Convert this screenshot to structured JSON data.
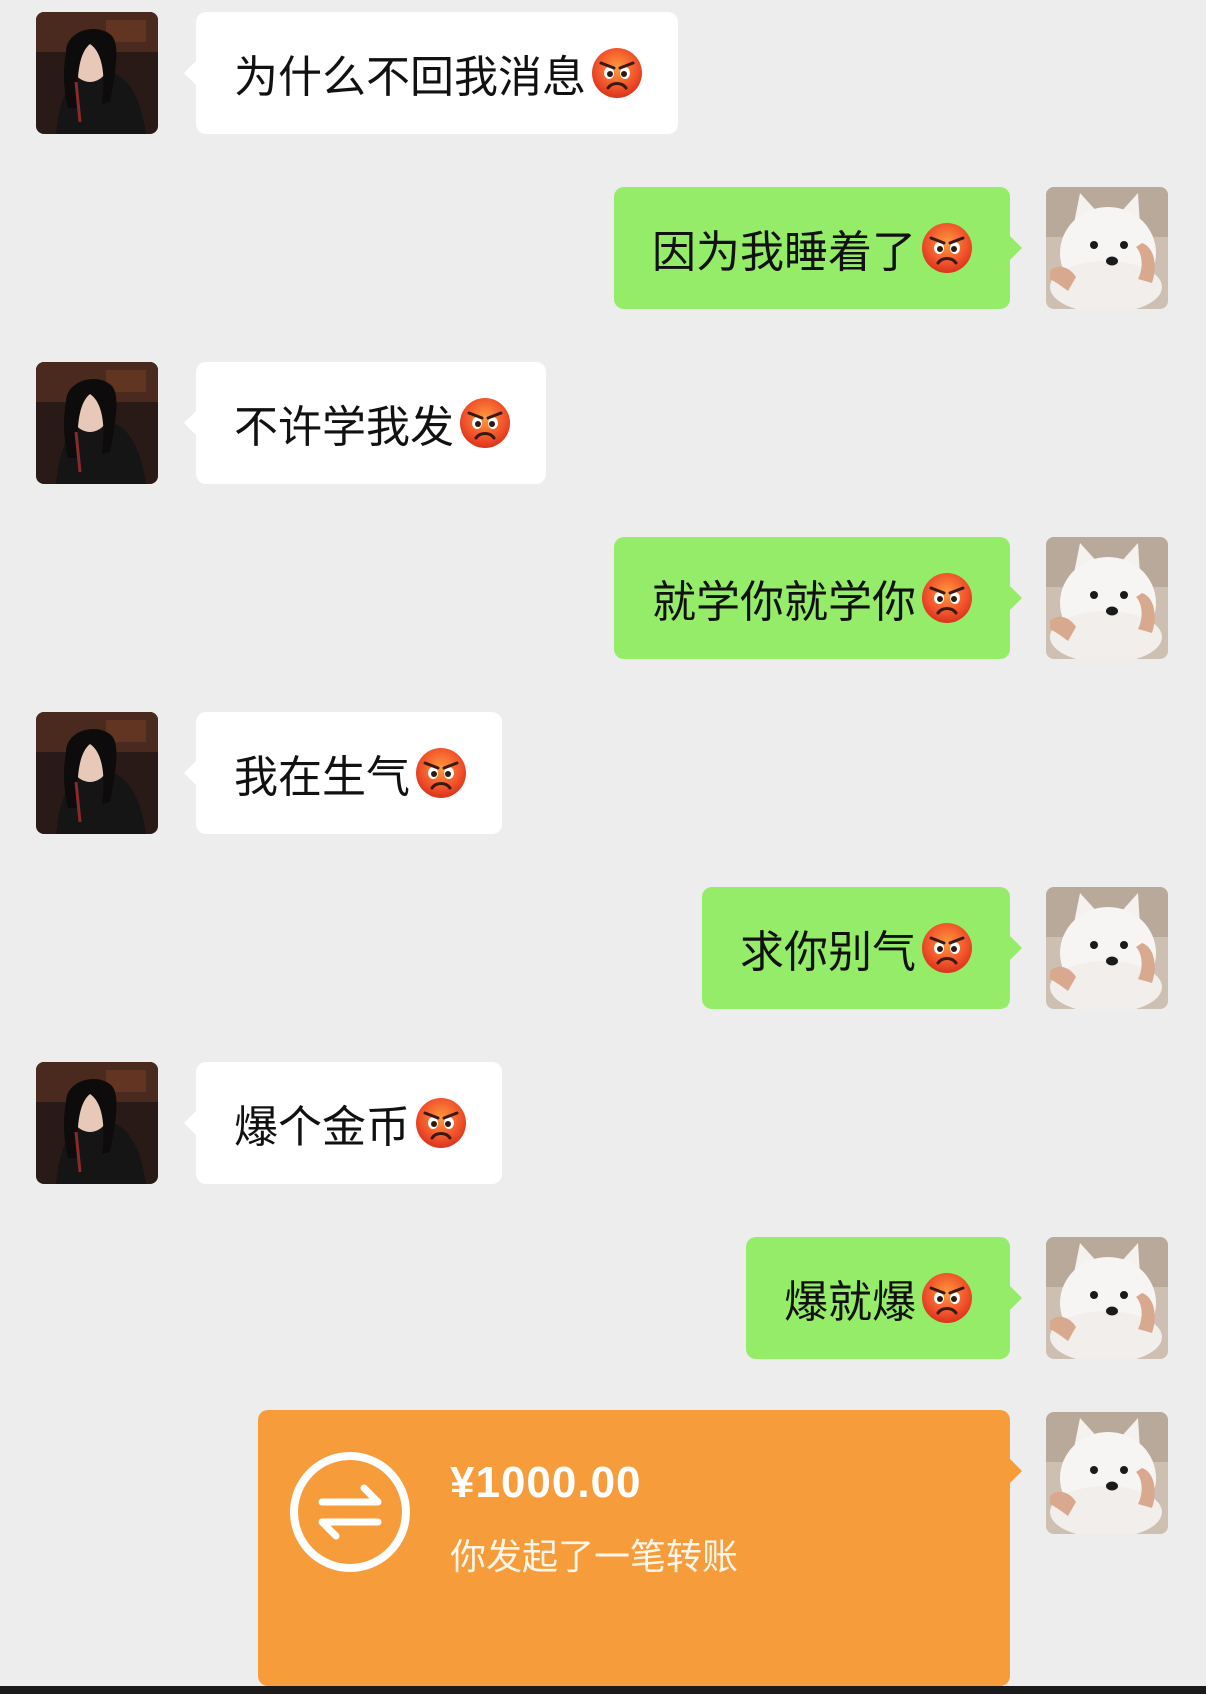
{
  "messages": [
    {
      "side": "in",
      "text": "为什么不回我消息",
      "emoji": "angry-face"
    },
    {
      "side": "out",
      "text": "因为我睡着了",
      "emoji": "angry-face"
    },
    {
      "side": "in",
      "text": "不许学我发",
      "emoji": "angry-face"
    },
    {
      "side": "out",
      "text": "就学你就学你",
      "emoji": "angry-face"
    },
    {
      "side": "in",
      "text": "我在生气",
      "emoji": "angry-face"
    },
    {
      "side": "out",
      "text": "求你别气",
      "emoji": "angry-face"
    },
    {
      "side": "in",
      "text": "爆个金币",
      "emoji": "angry-face"
    },
    {
      "side": "out",
      "text": "爆就爆",
      "emoji": "angry-face"
    }
  ],
  "transfer": {
    "amount": "¥1000.00",
    "description": "你发起了一笔转账",
    "icon": "transfer-arrows-icon",
    "color": "#f79c3b"
  },
  "colors": {
    "background": "#ededed",
    "incoming_bubble": "#ffffff",
    "outgoing_bubble": "#95ec69"
  },
  "avatars": {
    "contact": "woman-dark-hair-avatar",
    "self": "white-dog-avatar"
  }
}
